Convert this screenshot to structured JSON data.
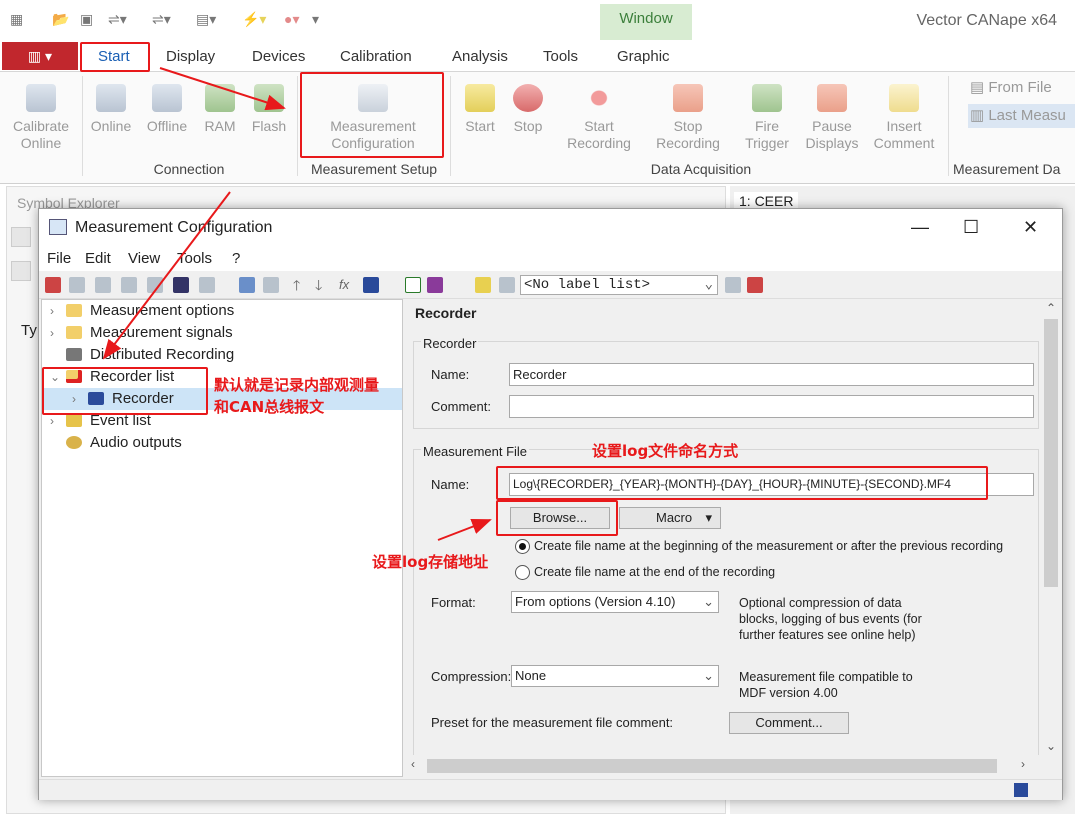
{
  "app": {
    "title": "Vector CANape x64"
  },
  "ribbon_tabs": {
    "window_context": "Window",
    "items": [
      "Start",
      "Display",
      "Devices",
      "Calibration",
      "Analysis",
      "Tools",
      "Graphic"
    ]
  },
  "ribbon": {
    "calibrate_online": "Calibrate\nOnline",
    "connection": {
      "online": "Online",
      "offline": "Offline",
      "ram": "RAM",
      "flash": "Flash",
      "group": "Connection"
    },
    "measurement_setup": {
      "button": "Measurement\nConfiguration",
      "group": "Measurement Setup"
    },
    "data_acquisition": {
      "start": "Start",
      "stop": "Stop",
      "start_recording": "Start\nRecording",
      "stop_recording": "Stop\nRecording",
      "fire_trigger": "Fire\nTrigger",
      "pause_displays": "Pause\nDisplays",
      "insert_comment": "Insert\nComment",
      "group": "Data Acquisition"
    },
    "measurement_data": {
      "from_file": "From File",
      "last_measurement": "Last Measu",
      "group": "Measurement Da"
    }
  },
  "background": {
    "symbol_explorer": "Symbol Explorer",
    "col_type": "Ty",
    "window_tab": "1: CEER"
  },
  "dialog": {
    "title": "Measurement Configuration",
    "menu": [
      "File",
      "Edit",
      "View",
      "Tools",
      "?"
    ],
    "label_list": "<No label list>",
    "tree": [
      "Measurement options",
      "Measurement signals",
      "Distributed Recording",
      "Recorder list",
      "Recorder",
      "Event list",
      "Audio outputs"
    ],
    "panel": {
      "heading": "Recorder",
      "recorder_group": "Recorder",
      "name_label": "Name:",
      "name_value": "Recorder",
      "comment_label": "Comment:",
      "comment_value": "",
      "mf_group": "Measurement File",
      "mf_name_label": "Name:",
      "mf_name_value": "Log\\{RECORDER}_{YEAR}-{MONTH}-{DAY}_{HOUR}-{MINUTE}-{SECOND}.MF4",
      "browse": "Browse...",
      "macro": "Macro",
      "radio1": "Create file name at the beginning of the measurement or after the previous recording",
      "radio2": "Create file name at the end of the recording",
      "format_label": "Format:",
      "format_value": "From options (Version 4.10)",
      "format_note": "Optional compression of data blocks, logging of bus events (for further features see online help)",
      "compression_label": "Compression:",
      "compression_value": "None",
      "compression_note": "Measurement file compatible to MDF version 4.00",
      "preset_label": "Preset for the measurement file comment:",
      "comment_button": "Comment..."
    }
  },
  "annotations": {
    "a1": "默认就是记录内部观测量",
    "a2": "和CAN总线报文",
    "a3": "设置log文件命名方式",
    "a4": "设置log存储地址"
  },
  "colors": {
    "accent_red": "#e8191b",
    "file_tab": "#c1272d",
    "window_context": "#d8ecd2"
  }
}
